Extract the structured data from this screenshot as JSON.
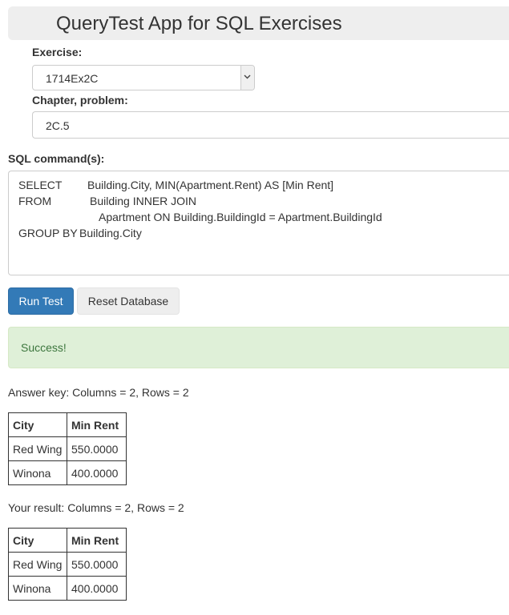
{
  "header": {
    "title": "QueryTest App for SQL Exercises"
  },
  "exercise": {
    "label": "Exercise:",
    "selected": "1714Ex2C"
  },
  "chapter": {
    "label": "Chapter, problem:",
    "value": "2C.5"
  },
  "sql": {
    "label": "SQL command(s):",
    "lines": [
      {
        "keyword": "SELECT",
        "text": "Building.City, MIN(Apartment.Rent) AS [Min Rent]"
      },
      {
        "keyword": "FROM",
        "text": "Building INNER JOIN"
      },
      {
        "keyword": "",
        "text": "Apartment ON Building.BuildingId = Apartment.BuildingId"
      },
      {
        "keyword": "GROUP BY",
        "text": "Building.City"
      }
    ]
  },
  "buttons": {
    "run": "Run Test",
    "reset": "Reset Database"
  },
  "alert": {
    "text": "Success!"
  },
  "answer_key": {
    "summary": "Answer key: Columns = 2, Rows = 2",
    "headers": [
      "City",
      "Min Rent"
    ],
    "rows": [
      [
        "Red Wing",
        "550.0000"
      ],
      [
        "Winona",
        "400.0000"
      ]
    ]
  },
  "your_result": {
    "summary": "Your result: Columns = 2, Rows = 2",
    "headers": [
      "City",
      "Min Rent"
    ],
    "rows": [
      [
        "Red Wing",
        "550.0000"
      ],
      [
        "Winona",
        "400.0000"
      ]
    ]
  },
  "icons": {
    "select_arrow": "chevron-down-icon"
  }
}
